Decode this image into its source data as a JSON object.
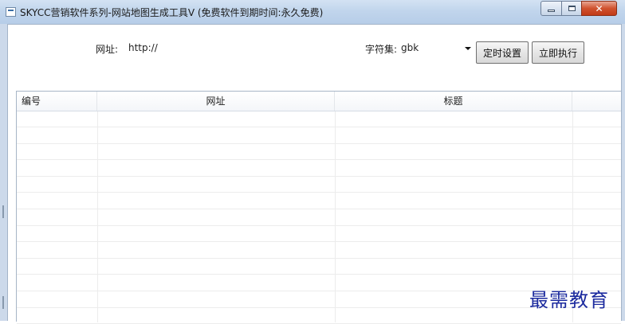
{
  "window": {
    "title": "SKYCC营销软件系列-网站地图生成工具V (免费软件到期时间:永久免费)",
    "controls": {
      "minimize": "minimize-icon",
      "maximize": "maximize-icon",
      "close": "close-icon"
    }
  },
  "form": {
    "url_label": "网址:",
    "url_value": "http://",
    "charset_label": "字符集:",
    "charset_value": "gbk",
    "schedule_button": "定时设置",
    "run_button": "立即执行"
  },
  "table": {
    "columns": [
      "编号",
      "网址",
      "标题",
      ""
    ],
    "rows": []
  },
  "watermark": "最需教育",
  "colors": {
    "title_bg": "#c1d5ec",
    "close_button": "#c8452a",
    "watermark": "#1b2a9e"
  }
}
